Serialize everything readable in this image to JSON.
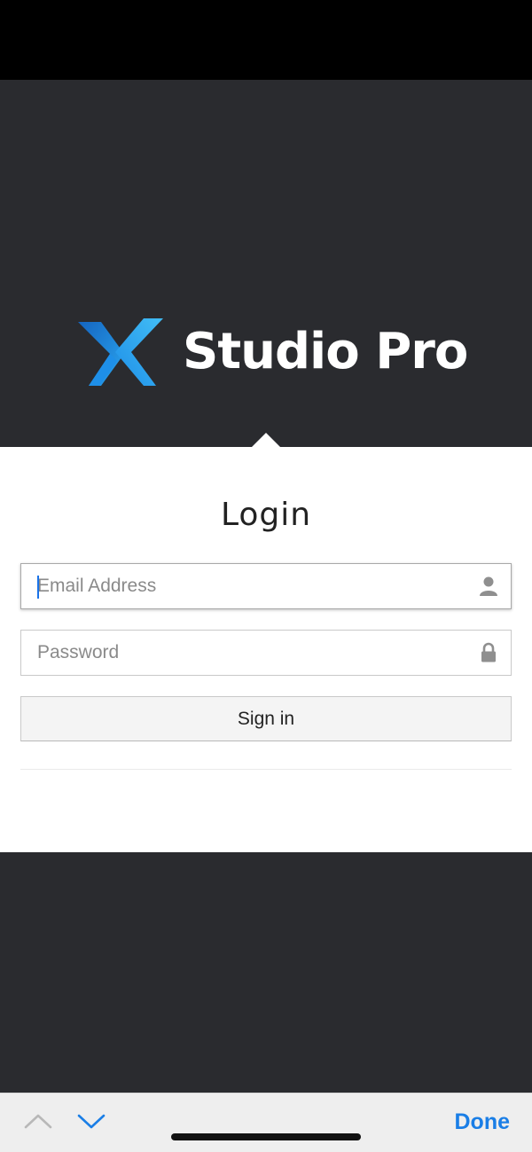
{
  "brand": {
    "name": "Studio Pro",
    "logo_icon": "studio-pro-x-logo",
    "logo_colors": [
      "#1e8fe8",
      "#42bdf5",
      "#1565c0"
    ]
  },
  "login": {
    "title": "Login",
    "email": {
      "placeholder": "Email Address",
      "value": "",
      "icon": "user-icon",
      "focused": true
    },
    "password": {
      "placeholder": "Password",
      "value": "",
      "icon": "lock-icon"
    },
    "signin_label": "Sign in"
  },
  "keyboard_toolbar": {
    "prev_icon": "chevron-up-icon",
    "next_icon": "chevron-down-icon",
    "done_label": "Done"
  },
  "colors": {
    "background": "#2a2b2f",
    "accent": "#1a7ee6",
    "card": "#ffffff"
  }
}
